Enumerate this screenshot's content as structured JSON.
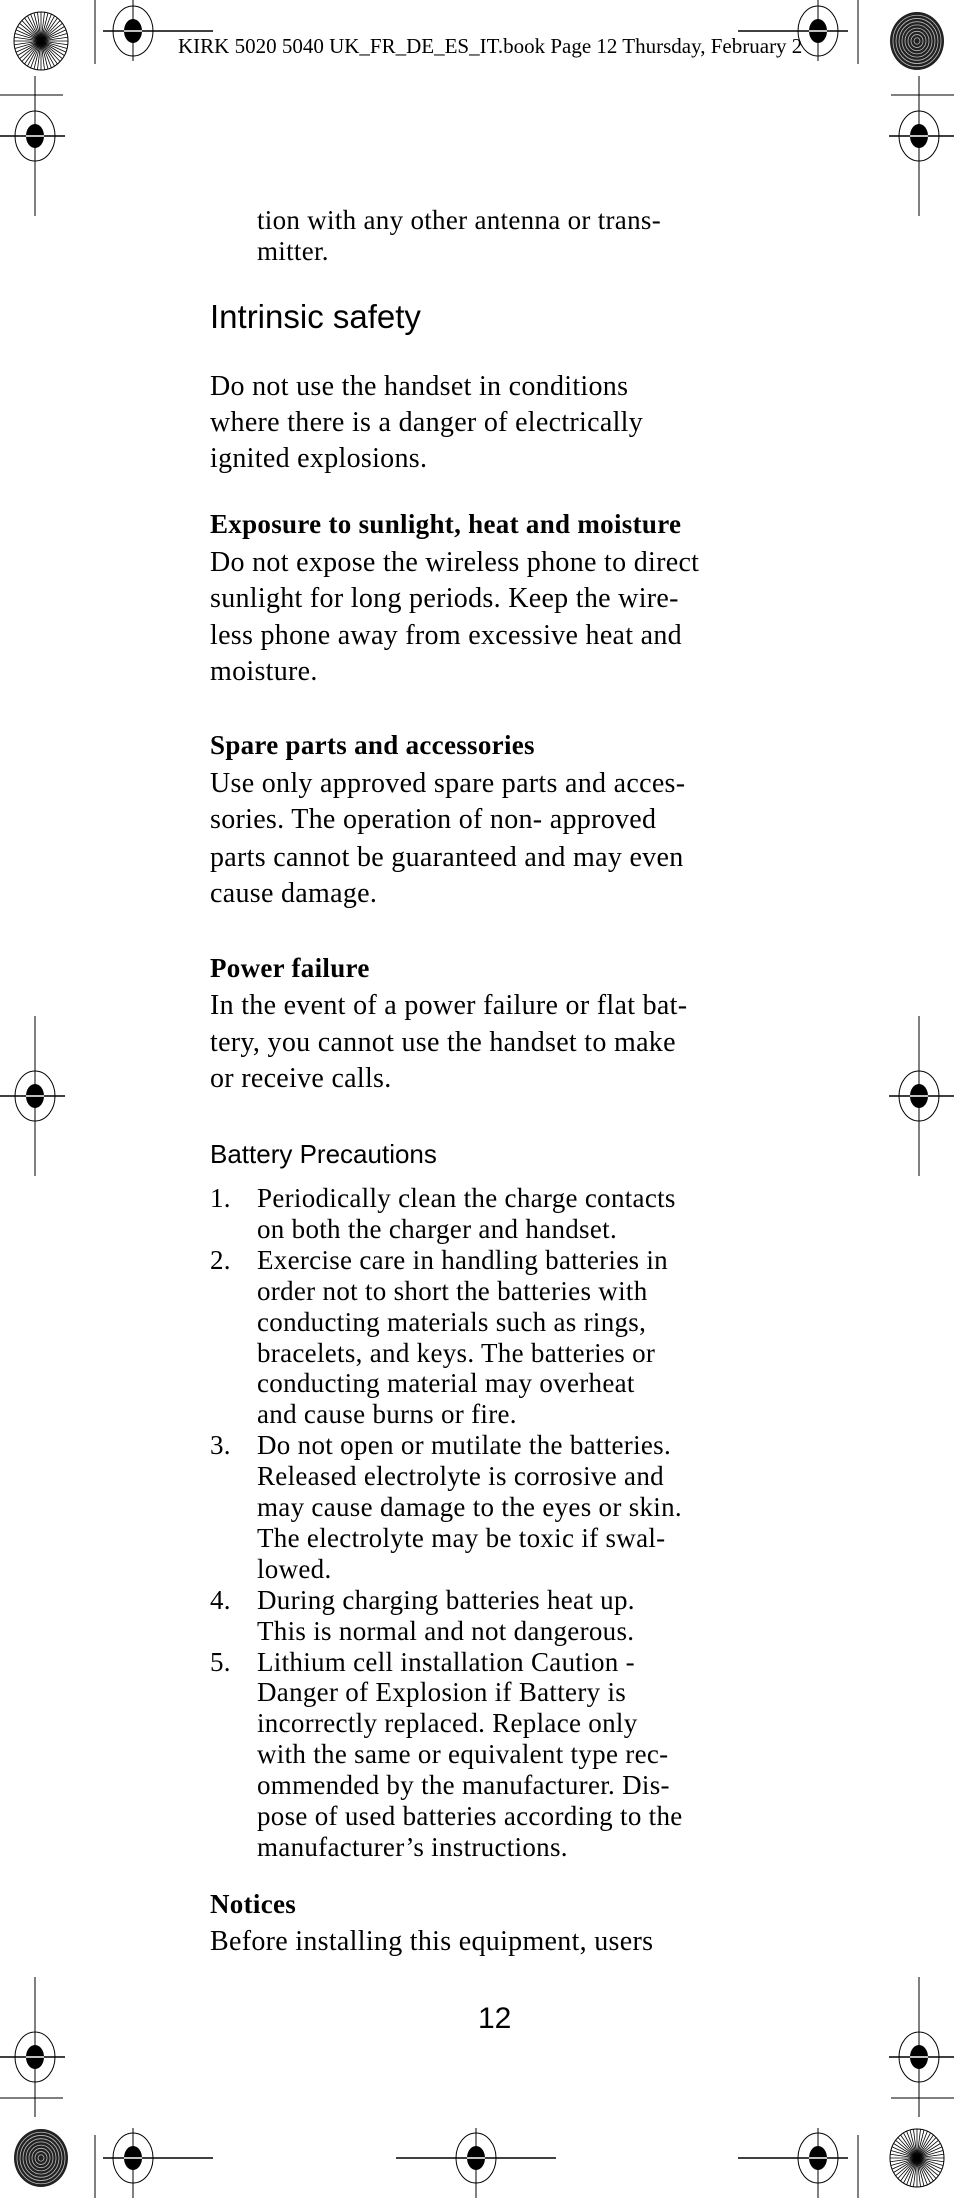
{
  "header": {
    "slug": "KIRK 5020 5040 UK_FR_DE_ES_IT.book  Page 12  Thursday, February 2"
  },
  "continuation": [
    "tion with any other antenna or trans-",
    "mitter."
  ],
  "intrinsic": {
    "title": "Intrinsic safety",
    "lines": [
      "Do not use the handset in conditions",
      "where there is a danger of electrically",
      "ignited explosions."
    ]
  },
  "exposure": {
    "title": "Exposure to sunlight, heat and moisture",
    "lines": [
      "Do not expose the wireless phone to direct",
      "sunlight for long periods. Keep the wire-",
      "less phone away from excessive heat and",
      "moisture."
    ]
  },
  "spare": {
    "title": "Spare parts and accessories",
    "lines": [
      "Use only approved spare parts and acces-",
      "sories. The operation of non- approved",
      "parts cannot be guaranteed and may even",
      "cause damage."
    ]
  },
  "power": {
    "title": "Power failure",
    "lines": [
      "In the event of a power failure or flat bat-",
      "tery, you cannot use the handset to make",
      "or receive calls."
    ]
  },
  "battery": {
    "title": "Battery Precautions",
    "items": [
      {
        "num": "1.",
        "lines": [
          "Periodically clean the charge contacts",
          "on both the charger and handset."
        ]
      },
      {
        "num": "2.",
        "lines": [
          "Exercise care in handling batteries in",
          "order not to short the batteries with",
          "conducting materials such as rings,",
          "bracelets, and keys. The batteries or",
          "conducting material may overheat",
          "and cause burns or fire."
        ]
      },
      {
        "num": "3.",
        "lines": [
          "Do not open or mutilate the batteries.",
          "Released electrolyte is corrosive and",
          "may cause damage to the eyes or skin.",
          "The electrolyte may be toxic if swal-",
          "lowed."
        ]
      },
      {
        "num": "4.",
        "lines": [
          "During charging batteries heat up.",
          "This is normal and not dangerous."
        ]
      },
      {
        "num": "5.",
        "lines": [
          "Lithium cell installation Caution -",
          "Danger of Explosion if Battery is",
          "incorrectly replaced. Replace only",
          "with the same or equivalent type rec-",
          "ommended by the manufacturer. Dis-",
          "pose of used batteries according to the",
          "manufacturer’s instructions."
        ]
      }
    ]
  },
  "notices": {
    "title": "Notices",
    "lines": [
      "Before installing this equipment, users"
    ]
  },
  "page_number": "12"
}
